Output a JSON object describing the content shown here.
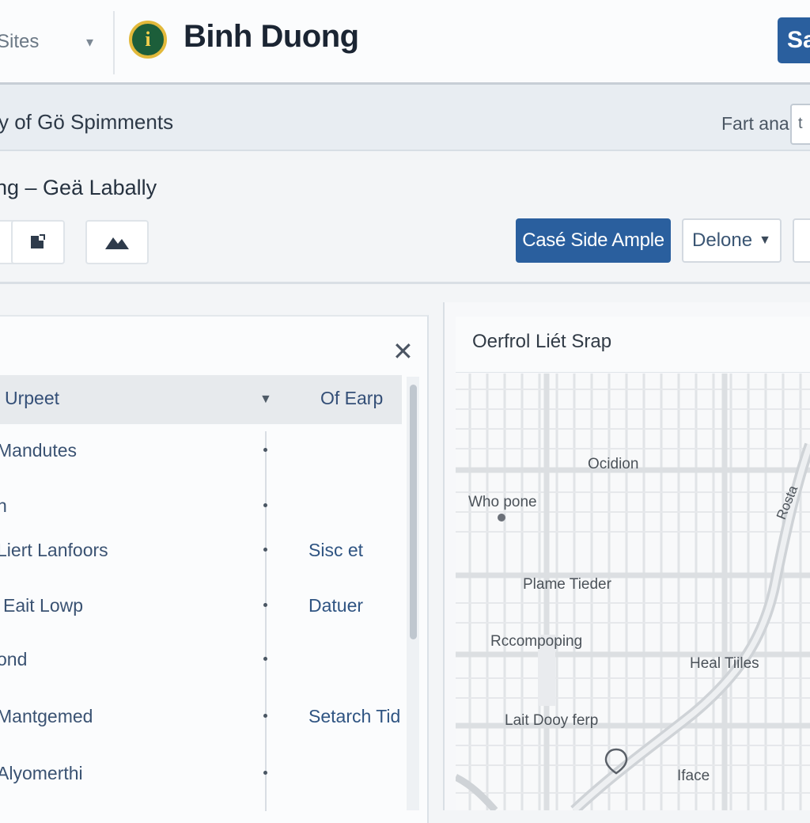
{
  "header": {
    "site_selector": "Sites",
    "brand_title": "Binh Duong",
    "action_label": "Sa"
  },
  "breadcrumb": {
    "text": "y of Gö Spimments",
    "filter_label": "Fart anal",
    "filter_value": "t"
  },
  "subheader": {
    "title": "ng – Geä Labally",
    "primary_button": "Casé Side Ample",
    "dropdown_button": "Delone"
  },
  "list_panel": {
    "header": {
      "col_a": "Urpeet",
      "col_b": "Of Earp"
    },
    "rows": [
      {
        "label": "Mandutes",
        "value": ""
      },
      {
        "label": "n",
        "value": ""
      },
      {
        "label": "Liert Lanfoors",
        "value": "Sisc et"
      },
      {
        "label": "Eait Lowp",
        "value": "Datuer"
      },
      {
        "label": "ond",
        "value": ""
      },
      {
        "label": "Mantgemed",
        "value": "Setarch Tid"
      },
      {
        "label": "Alyomerthi",
        "value": ""
      }
    ]
  },
  "map_panel": {
    "title": "Oerfrol Liét Srap",
    "labels": {
      "ocidion": "Ocidion",
      "who_pone": "Who pone",
      "plame": "Plame Tieder",
      "reconping": "Rccompoping",
      "heal": "Heal Tiiles",
      "lait": "Lait Dooy ferp",
      "iface": "Iface",
      "road": "Rosta"
    }
  },
  "colors": {
    "primary": "#2a5f9e",
    "logo_green": "#1c5e3a",
    "logo_gold": "#e2b93b"
  }
}
